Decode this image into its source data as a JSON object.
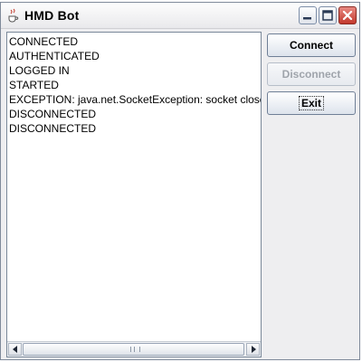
{
  "window": {
    "title": "HMD Bot",
    "icons": {
      "app": "java-cup-icon",
      "minimize": "minimize-icon",
      "maximize": "maximize-icon",
      "close": "close-icon"
    }
  },
  "log": {
    "lines": [
      "CONNECTED",
      "AUTHENTICATED",
      "LOGGED IN",
      "STARTED",
      "EXCEPTION: java.net.SocketException: socket close",
      "DISCONNECTED",
      "DISCONNECTED"
    ]
  },
  "buttons": {
    "connect": "Connect",
    "disconnect": "Disconnect",
    "exit": "Exit"
  },
  "state": {
    "disconnect_enabled": false,
    "exit_focused": true
  },
  "colors": {
    "close_button": "#c3382c",
    "disabled_text": "#9fa4ab"
  }
}
